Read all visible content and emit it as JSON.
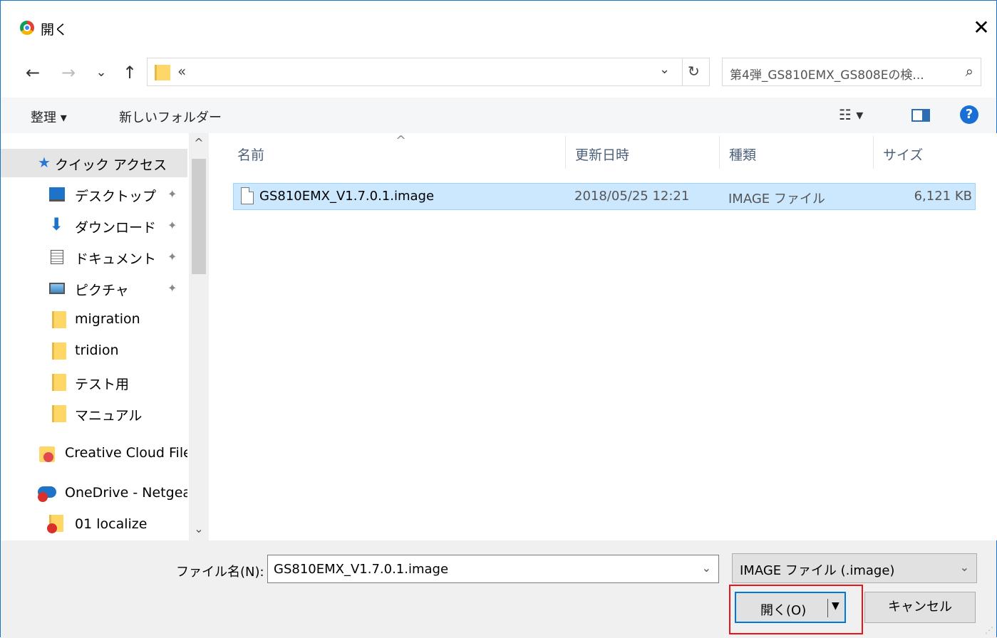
{
  "titlebar": {
    "title": "開く",
    "close": "✕"
  },
  "nav": {
    "back": "←",
    "forward": "→",
    "recent": "⌄",
    "up": "↑"
  },
  "address": {
    "chevron": "«",
    "dropdown": "⌄",
    "refresh": "↻"
  },
  "search": {
    "text": "第4弾_GS810EMX_GS808Eの検...",
    "icon": "⌕"
  },
  "toolbar": {
    "organize": "整理 ▾",
    "new_folder": "新しいフォルダー",
    "view_icon": "☷ ▾",
    "help": "?"
  },
  "sidebar": {
    "items": [
      {
        "label": "クイック アクセス",
        "icon": "star-icon",
        "pinned": false
      },
      {
        "label": "デスクトップ",
        "icon": "desktop-icon",
        "pinned": true
      },
      {
        "label": "ダウンロード",
        "icon": "download-icon",
        "pinned": true
      },
      {
        "label": "ドキュメント",
        "icon": "document-icon",
        "pinned": true
      },
      {
        "label": "ピクチャ",
        "icon": "picture-icon",
        "pinned": true
      },
      {
        "label": "migration",
        "icon": "folder-icon",
        "pinned": false
      },
      {
        "label": "tridion",
        "icon": "folder-icon",
        "pinned": false
      },
      {
        "label": "テスト用",
        "icon": "folder-icon",
        "pinned": false
      },
      {
        "label": "マニュアル",
        "icon": "folder-icon",
        "pinned": false
      },
      {
        "label": "Creative Cloud File",
        "icon": "creative-cloud-icon",
        "pinned": false
      },
      {
        "label": "OneDrive - Netgea",
        "icon": "onedrive-icon",
        "pinned": false
      },
      {
        "label": "01 localize",
        "icon": "folder-error-icon",
        "pinned": false
      }
    ],
    "pin": "✦",
    "scroll_up": "^",
    "scroll_down": "⌄"
  },
  "filelist": {
    "columns": [
      "名前",
      "更新日時",
      "種類",
      "サイズ"
    ],
    "sort_arrow": "^",
    "rows": [
      {
        "name": "GS810EMX_V1.7.0.1.image",
        "modified": "2018/05/25 12:21",
        "type": "IMAGE ファイル",
        "size": "6,121 KB"
      }
    ]
  },
  "bottom": {
    "filename_label": "ファイル名(N):",
    "filename_value": "GS810EMX_V1.7.0.1.image",
    "filetype_value": "IMAGE ファイル (.image)",
    "open_label": "開く(O)",
    "cancel_label": "キャンセル",
    "dropdown": "⌄",
    "split_arrow": "▼"
  },
  "colors": {
    "accent": "#0078d7",
    "highlight": "#e8141a",
    "selection": "#cce8ff"
  }
}
